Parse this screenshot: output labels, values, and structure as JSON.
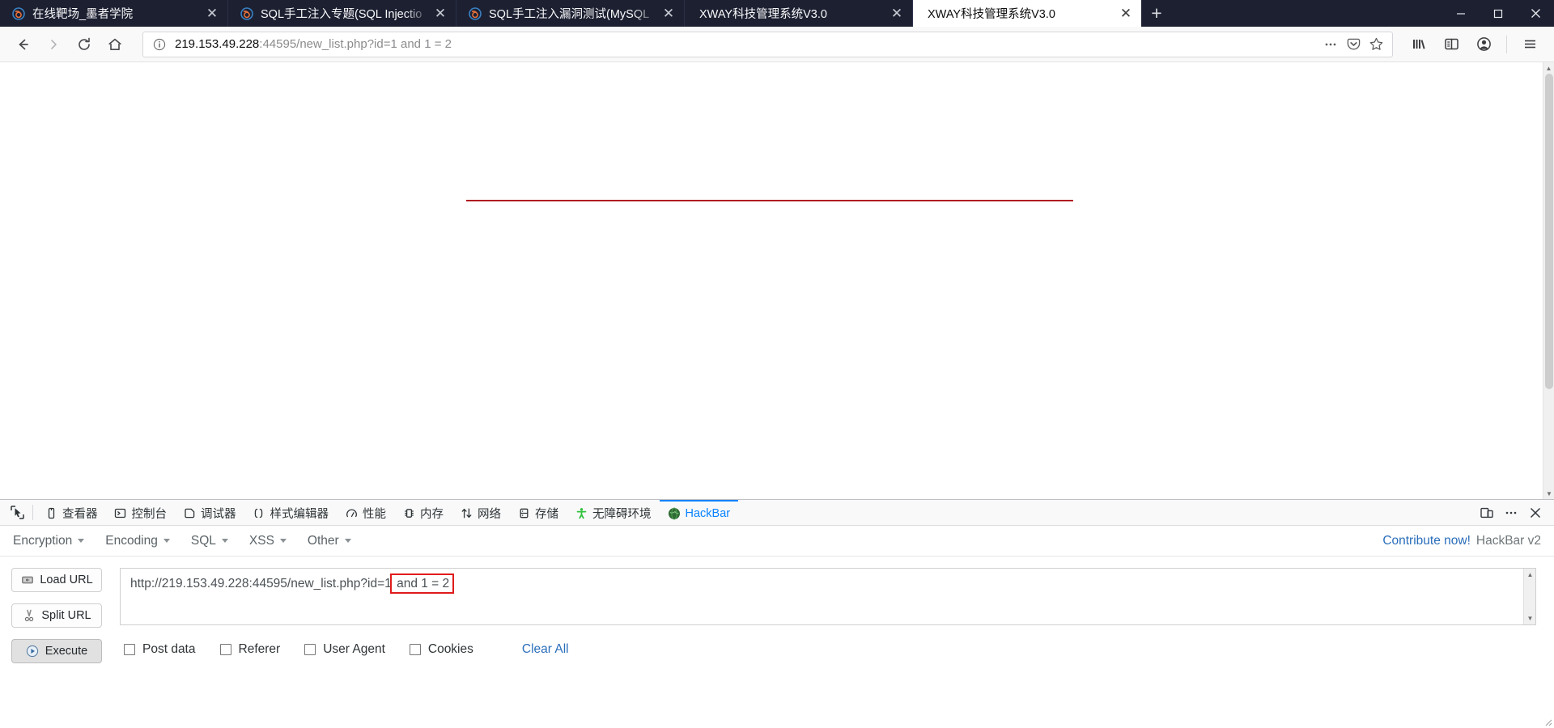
{
  "browser": {
    "tabs": [
      {
        "title": "在线靶场_墨者学院",
        "favicon": "firefox-icon",
        "active": false,
        "close_label": "✕"
      },
      {
        "title": "SQL手工注入专题(SQL Injectio",
        "favicon": "firefox-icon",
        "active": false,
        "close_label": "✕"
      },
      {
        "title": "SQL手工注入漏洞测试(MySQL",
        "favicon": "firefox-icon",
        "active": false,
        "close_label": "✕"
      },
      {
        "title": "XWAY科技管理系统V3.0",
        "favicon": "none",
        "active": false,
        "close_label": "✕"
      },
      {
        "title": "XWAY科技管理系统V3.0",
        "favicon": "none",
        "active": true,
        "close_label": "✕"
      }
    ],
    "new_tab_label": "+",
    "window_controls": {
      "minimize": "—",
      "maximize": "❐",
      "close": "✕"
    },
    "nav": {
      "back": "back-arrow-icon",
      "forward": "forward-arrow-icon",
      "reload": "reload-icon",
      "home": "home-icon"
    },
    "urlbar": {
      "identity_icon": "info-circle-icon",
      "host": "219.153.49.228",
      "path": ":44595/new_list.php?id=1 and 1 = 2",
      "full_url": "219.153.49.228:44595/new_list.php?id=1 and 1 = 2",
      "page_actions": "ellipsis-icon",
      "pocket": "pocket-icon",
      "bookmark": "star-icon"
    },
    "toolbar_right": {
      "library": "library-icon",
      "sidebar": "sidebar-icon",
      "account": "account-icon",
      "menu": "hamburger-menu-icon"
    }
  },
  "page": {
    "divider": "red-horizontal-rule",
    "divider_color": "#b01a22",
    "scrollbar": {
      "up": "▲",
      "down": "▼"
    }
  },
  "devtools": {
    "picker_icon": "element-picker-icon",
    "tabs": [
      {
        "label": "查看器",
        "icon": "inspector-icon",
        "active": false
      },
      {
        "label": "控制台",
        "icon": "console-icon",
        "active": false
      },
      {
        "label": "调试器",
        "icon": "debugger-icon",
        "active": false
      },
      {
        "label": "样式编辑器",
        "icon": "style-editor-icon",
        "active": false
      },
      {
        "label": "性能",
        "icon": "performance-icon",
        "active": false
      },
      {
        "label": "内存",
        "icon": "memory-icon",
        "active": false
      },
      {
        "label": "网络",
        "icon": "network-icon",
        "active": false
      },
      {
        "label": "存储",
        "icon": "storage-icon",
        "active": false
      },
      {
        "label": "无障碍环境",
        "icon": "accessibility-icon",
        "active": false
      },
      {
        "label": "HackBar",
        "icon": "hackbar-globe-icon",
        "active": true
      }
    ],
    "active_tab_color": "#0a84ff",
    "controls": {
      "responsive": "responsive-design-mode-icon",
      "more": "more-options-icon",
      "close": "close-devtools-icon"
    }
  },
  "hackbar": {
    "menus": [
      {
        "label": "Encryption"
      },
      {
        "label": "Encoding"
      },
      {
        "label": "SQL"
      },
      {
        "label": "XSS"
      },
      {
        "label": "Other"
      }
    ],
    "contribute_label": "Contribute now!",
    "version_label": "HackBar v2",
    "buttons": [
      {
        "label": "Load URL",
        "icon": "load-url-icon",
        "pressed": false
      },
      {
        "label": "Split URL",
        "icon": "split-url-icon",
        "pressed": false
      },
      {
        "label": "Execute",
        "icon": "execute-play-icon",
        "pressed": true
      }
    ],
    "url_field": {
      "value": "http://219.153.49.228:44595/new_list.php?id=1 and 1 = 2",
      "base": "http://219.153.49.228:44595/new_list.php?id=1",
      "highlighted": " and 1 = 2",
      "highlight_color": "#e01b1b"
    },
    "checkboxes": [
      {
        "label": "Post data",
        "checked": false
      },
      {
        "label": "Referer",
        "checked": false
      },
      {
        "label": "User Agent",
        "checked": false
      },
      {
        "label": "Cookies",
        "checked": false
      }
    ],
    "clear_all_label": "Clear All",
    "link_color": "#2a6ebb"
  }
}
